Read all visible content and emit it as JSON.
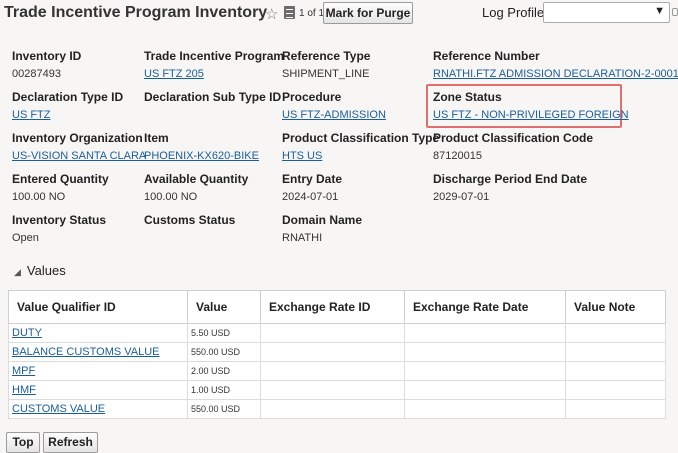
{
  "header": {
    "title": "Trade Incentive Program Inventory",
    "record_count": "1 of 1",
    "purge_button": "Mark for Purge",
    "log_profile_label": "Log Profile",
    "log_profile_value": ""
  },
  "fields": {
    "inventory_id": {
      "label": "Inventory ID",
      "value": "00287493"
    },
    "trade_incentive_program": {
      "label": "Trade Incentive Program",
      "value": "US FTZ 205"
    },
    "reference_type": {
      "label": "Reference Type",
      "value": "SHIPMENT_LINE"
    },
    "reference_number": {
      "label": "Reference Number",
      "value": "RNATHI.FTZ ADMISSION DECLARATION-2-0001"
    },
    "declaration_type_id": {
      "label": "Declaration Type ID",
      "value": "US FTZ"
    },
    "declaration_sub_type_id": {
      "label": "Declaration Sub Type ID",
      "value": ""
    },
    "procedure": {
      "label": "Procedure",
      "value": "US FTZ-ADMISSION"
    },
    "zone_status": {
      "label": "Zone Status",
      "value": "US FTZ - NON-PRIVILEGED FOREIGN"
    },
    "inventory_organization": {
      "label": "Inventory Organization",
      "value": "US-VISION SANTA CLARA"
    },
    "item": {
      "label": "Item",
      "value": "PHOENIX-KX620-BIKE"
    },
    "product_classification_type": {
      "label": "Product Classification Type",
      "value": "HTS US"
    },
    "product_classification_code": {
      "label": "Product Classification Code",
      "value": "87120015"
    },
    "entered_quantity": {
      "label": "Entered Quantity",
      "value": "100.00 NO"
    },
    "available_quantity": {
      "label": "Available Quantity",
      "value": "100.00 NO"
    },
    "entry_date": {
      "label": "Entry Date",
      "value": "2024-07-01"
    },
    "discharge_period_end_date": {
      "label": "Discharge Period End Date",
      "value": "2029-07-01"
    },
    "inventory_status": {
      "label": "Inventory Status",
      "value": "Open"
    },
    "customs_status": {
      "label": "Customs Status",
      "value": ""
    },
    "domain_name": {
      "label": "Domain Name",
      "value": "RNATHI"
    }
  },
  "values_section": {
    "title": "Values",
    "columns": [
      "Value Qualifier ID",
      "Value",
      "Exchange Rate ID",
      "Exchange Rate Date",
      "Value Note"
    ],
    "rows": [
      {
        "qualifier": "DUTY",
        "value": "5.50 USD"
      },
      {
        "qualifier": "BALANCE CUSTOMS VALUE",
        "value": "550.00 USD"
      },
      {
        "qualifier": "MPF",
        "value": "2.00 USD"
      },
      {
        "qualifier": "HMF",
        "value": "1.00 USD"
      },
      {
        "qualifier": "CUSTOMS VALUE",
        "value": "550.00 USD"
      }
    ]
  },
  "footer": {
    "top_button": "Top",
    "refresh_button": "Refresh"
  },
  "colors": {
    "link": "#1a5e9b",
    "highlight_border": "#e07070",
    "background": "#f7f6f5"
  }
}
